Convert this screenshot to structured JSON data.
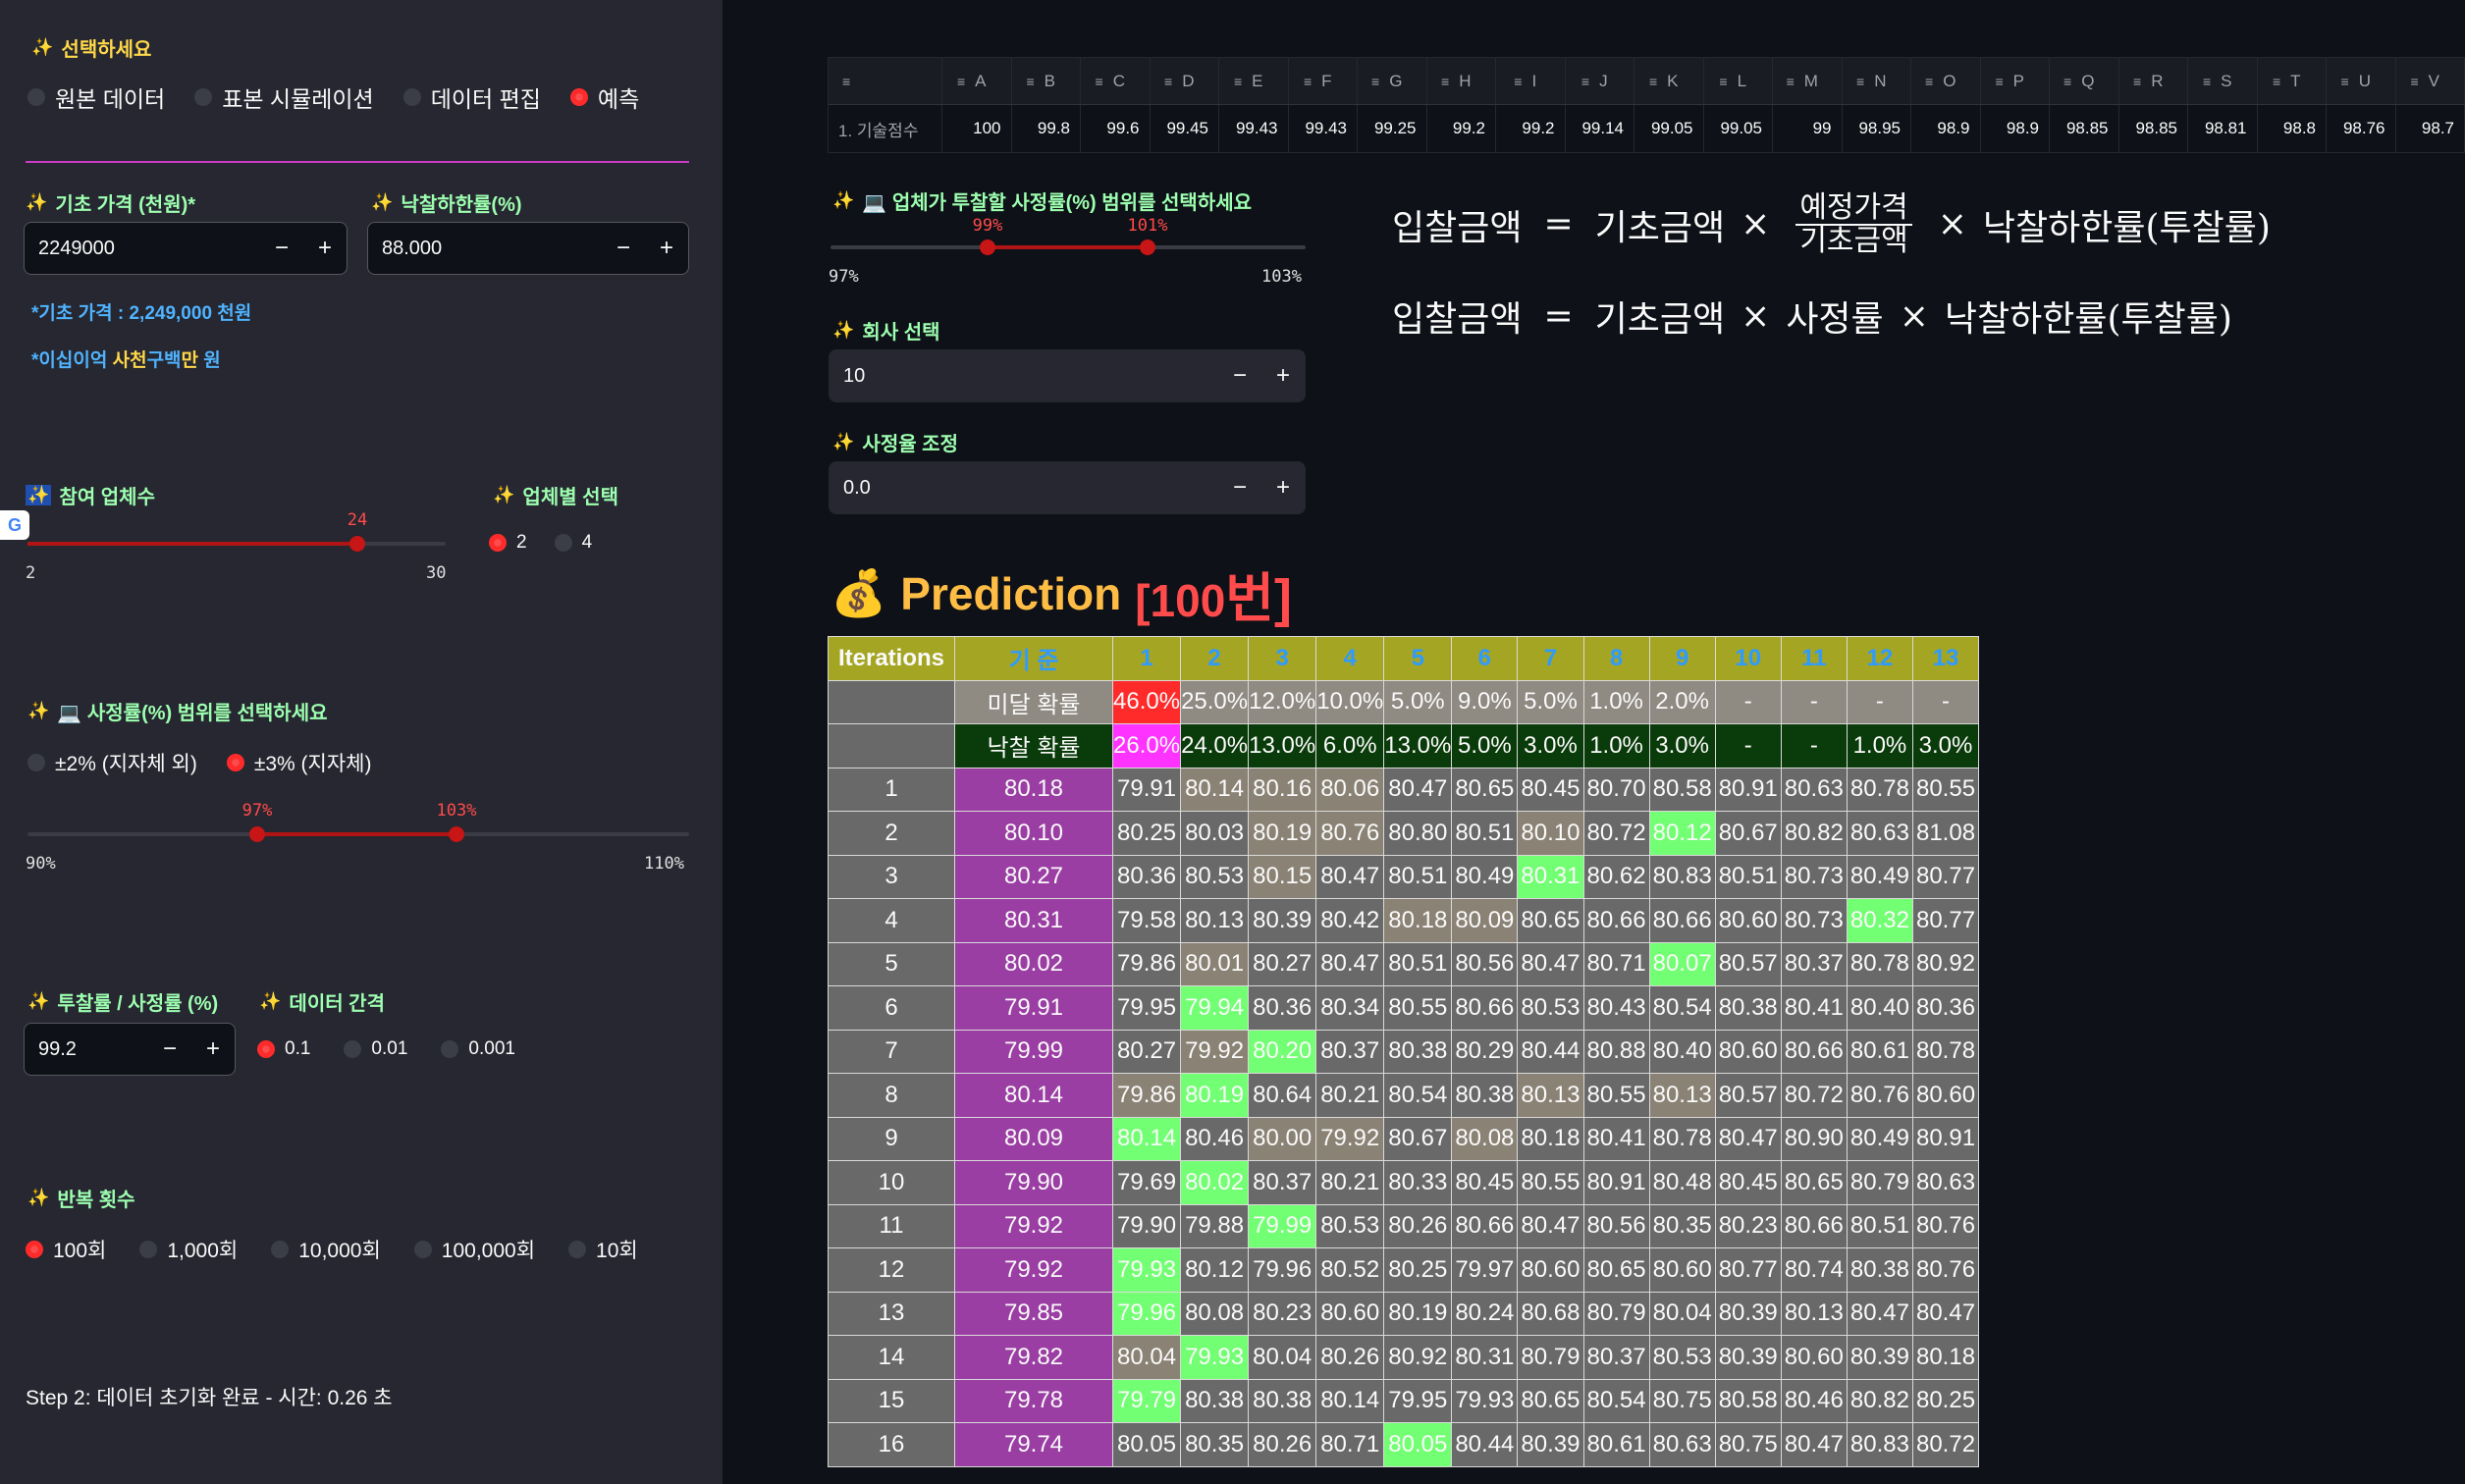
{
  "sidebar": {
    "select_label": "선택하세요",
    "mode_options": [
      "원본 데이터",
      "표본 시뮬레이션",
      "데이터 편집",
      "예측"
    ],
    "mode_selected": 3,
    "base_price_label": "기초 가격 (천원)*",
    "base_price_value": "2249000",
    "lower_rate_label": "낙찰하한률(%)",
    "lower_rate_value": "88.000",
    "base_price_info_prefix": "*기초 가격 : ",
    "base_price_info_value": "2,249,000",
    "base_price_info_suffix": " 천원",
    "price_words_prefix": "*",
    "price_words_blue1": "이십이억 ",
    "price_words_yellow1": "사천",
    "price_words_blue2": "구백",
    "price_words_yellow2": "만",
    "price_words_suffix": " 원",
    "participants_label": "참여 업체수",
    "participants_value": "24",
    "participants_min": "2",
    "participants_max": "30",
    "per_company_label": "업체별 선택",
    "per_company_options": [
      "2",
      "4"
    ],
    "per_company_selected": 0,
    "rate_range_label": "💻 사정률(%) 범위를 선택하세요",
    "rate_range_options": [
      "±2% (지자체 외)",
      "±3% (지자체)"
    ],
    "rate_range_selected": 1,
    "rate_slider_low": "97%",
    "rate_slider_high": "103%",
    "rate_slider_min": "90%",
    "rate_slider_max": "110%",
    "bid_rate_label": "투찰률 / 사정률 (%)",
    "bid_rate_value": "99.2",
    "interval_label": "데이터 간격",
    "interval_options": [
      "0.1",
      "0.01",
      "0.001"
    ],
    "interval_selected": 0,
    "repeat_label": "반복 횟수",
    "repeat_options": [
      "100회",
      "1,000회",
      "10,000회",
      "100,000회",
      "10회"
    ],
    "repeat_selected": 0,
    "step_text": "Step 2: 데이터 초기화 완료 - 시간: 0.26 초"
  },
  "top_table": {
    "headers": [
      "A",
      "B",
      "C",
      "D",
      "E",
      "F",
      "G",
      "H",
      "I",
      "J",
      "K",
      "L",
      "M",
      "N",
      "O",
      "P",
      "Q",
      "R",
      "S",
      "T",
      "U",
      "V"
    ],
    "row_label": "1. 기술점수",
    "values": [
      "100",
      "99.8",
      "99.6",
      "99.45",
      "99.43",
      "99.43",
      "99.25",
      "99.2",
      "99.2",
      "99.14",
      "99.05",
      "99.05",
      "99",
      "98.95",
      "98.9",
      "98.9",
      "98.85",
      "98.85",
      "98.81",
      "98.8",
      "98.76",
      "98.7"
    ]
  },
  "main_controls": {
    "company_range_label": "💻 업체가 투찰할 사정률(%) 범위를 선택하세요",
    "company_slider_low": "99%",
    "company_slider_high": "101%",
    "company_slider_min": "97%",
    "company_slider_max": "103%",
    "company_select_label": "회사 선택",
    "company_select_value": "10",
    "rate_adjust_label": "사정율 조정",
    "rate_adjust_value": "0.0"
  },
  "formula": {
    "line1_lhs": "입찰금액",
    "line1_a": "기초금액",
    "line1_num": "예정가격",
    "line1_den": "기초금액",
    "line1_b": "낙찰하한률(투찰률)",
    "line2_lhs": "입찰금액",
    "line2_a": "기초금액",
    "line2_b": "사정률",
    "line2_c": "낙찰하한률(투찰률)",
    "eq": "=",
    "times": "×"
  },
  "prediction": {
    "icon": "💰",
    "title": "Prediction",
    "bracket_num": "[100",
    "bracket_word": "번]",
    "iter_header": "Iterations",
    "base_header": "기 준",
    "columns": [
      "1",
      "2",
      "3",
      "4",
      "5",
      "6",
      "7",
      "8",
      "9",
      "10",
      "11",
      "12",
      "13"
    ],
    "miss_label": "미달 확률",
    "miss_values": [
      "46.0%",
      "25.0%",
      "12.0%",
      "10.0%",
      "5.0%",
      "9.0%",
      "5.0%",
      "1.0%",
      "2.0%",
      "-",
      "-",
      "-",
      "-"
    ],
    "win_label": "낙찰 확률",
    "win_values": [
      "26.0%",
      "24.0%",
      "13.0%",
      "6.0%",
      "13.0%",
      "5.0%",
      "3.0%",
      "1.0%",
      "3.0%",
      "-",
      "-",
      "1.0%",
      "3.0%"
    ],
    "rows": [
      {
        "i": "1",
        "base": "80.18",
        "v": [
          "79.91",
          "80.14",
          "80.16",
          "80.06",
          "80.47",
          "80.65",
          "80.45",
          "80.70",
          "80.58",
          "80.91",
          "80.63",
          "80.78",
          "80.55"
        ]
      },
      {
        "i": "2",
        "base": "80.10",
        "v": [
          "80.25",
          "80.03",
          "80.19",
          "80.76",
          "80.80",
          "80.51",
          "80.10",
          "80.72",
          "80.12",
          "80.67",
          "80.82",
          "80.63",
          "81.08"
        ]
      },
      {
        "i": "3",
        "base": "80.27",
        "v": [
          "80.36",
          "80.53",
          "80.15",
          "80.47",
          "80.51",
          "80.49",
          "80.31",
          "80.62",
          "80.83",
          "80.51",
          "80.73",
          "80.49",
          "80.77"
        ]
      },
      {
        "i": "4",
        "base": "80.31",
        "v": [
          "79.58",
          "80.13",
          "80.39",
          "80.42",
          "80.18",
          "80.09",
          "80.65",
          "80.66",
          "80.66",
          "80.60",
          "80.73",
          "80.32",
          "80.77"
        ]
      },
      {
        "i": "5",
        "base": "80.02",
        "v": [
          "79.86",
          "80.01",
          "80.27",
          "80.47",
          "80.51",
          "80.56",
          "80.47",
          "80.71",
          "80.07",
          "80.57",
          "80.37",
          "80.78",
          "80.92"
        ]
      },
      {
        "i": "6",
        "base": "79.91",
        "v": [
          "79.95",
          "79.94",
          "80.36",
          "80.34",
          "80.55",
          "80.66",
          "80.53",
          "80.43",
          "80.54",
          "80.38",
          "80.41",
          "80.40",
          "80.36"
        ]
      },
      {
        "i": "7",
        "base": "79.99",
        "v": [
          "80.27",
          "79.92",
          "80.20",
          "80.37",
          "80.38",
          "80.29",
          "80.44",
          "80.88",
          "80.40",
          "80.60",
          "80.66",
          "80.61",
          "80.78"
        ]
      },
      {
        "i": "8",
        "base": "80.14",
        "v": [
          "79.86",
          "80.19",
          "80.64",
          "80.21",
          "80.54",
          "80.38",
          "80.13",
          "80.55",
          "80.13",
          "80.57",
          "80.72",
          "80.76",
          "80.60"
        ]
      },
      {
        "i": "9",
        "base": "80.09",
        "v": [
          "80.14",
          "80.46",
          "80.00",
          "79.92",
          "80.67",
          "80.08",
          "80.18",
          "80.41",
          "80.78",
          "80.47",
          "80.90",
          "80.49",
          "80.91"
        ]
      },
      {
        "i": "10",
        "base": "79.90",
        "v": [
          "79.69",
          "80.02",
          "80.37",
          "80.21",
          "80.33",
          "80.45",
          "80.55",
          "80.91",
          "80.48",
          "80.45",
          "80.65",
          "80.79",
          "80.63"
        ]
      },
      {
        "i": "11",
        "base": "79.92",
        "v": [
          "79.90",
          "79.88",
          "79.99",
          "80.53",
          "80.26",
          "80.66",
          "80.47",
          "80.56",
          "80.35",
          "80.23",
          "80.66",
          "80.51",
          "80.76"
        ]
      },
      {
        "i": "12",
        "base": "79.92",
        "v": [
          "79.93",
          "80.12",
          "79.96",
          "80.52",
          "80.25",
          "79.97",
          "80.60",
          "80.65",
          "80.60",
          "80.77",
          "80.74",
          "80.38",
          "80.76"
        ]
      },
      {
        "i": "13",
        "base": "79.85",
        "v": [
          "79.96",
          "80.08",
          "80.23",
          "80.60",
          "80.19",
          "80.24",
          "80.68",
          "80.79",
          "80.04",
          "80.39",
          "80.13",
          "80.47",
          "80.47"
        ]
      },
      {
        "i": "14",
        "base": "79.82",
        "v": [
          "80.04",
          "79.93",
          "80.04",
          "80.26",
          "80.92",
          "80.31",
          "80.79",
          "80.37",
          "80.53",
          "80.39",
          "80.60",
          "80.39",
          "80.18"
        ]
      },
      {
        "i": "15",
        "base": "79.78",
        "v": [
          "79.79",
          "80.38",
          "80.38",
          "80.14",
          "79.95",
          "79.93",
          "80.65",
          "80.54",
          "80.75",
          "80.58",
          "80.46",
          "80.82",
          "80.25"
        ]
      },
      {
        "i": "16",
        "base": "79.74",
        "v": [
          "80.05",
          "80.35",
          "80.26",
          "80.71",
          "80.05",
          "80.44",
          "80.39",
          "80.61",
          "80.63",
          "80.75",
          "80.47",
          "80.83",
          "80.72"
        ]
      }
    ],
    "highlights": {
      "2": [
        9
      ],
      "3": [
        7
      ],
      "4": [
        12
      ],
      "5": [
        9
      ],
      "6": [
        2
      ],
      "7": [
        3
      ],
      "8": [
        2
      ],
      "9": [
        1
      ],
      "10": [
        2
      ],
      "11": [
        3
      ],
      "12": [
        1
      ],
      "13": [
        1
      ],
      "14": [
        2
      ],
      "15": [
        1
      ],
      "16": [
        5
      ]
    },
    "tan_cells": {
      "1": [
        2,
        3,
        4
      ],
      "2": [
        3,
        4,
        7
      ],
      "3": [
        3
      ],
      "4": [
        5,
        6
      ],
      "5": [
        2
      ],
      "7": [
        2
      ],
      "8": [
        1,
        7,
        9
      ],
      "9": [
        3,
        4,
        6
      ],
      "14": [
        1
      ]
    }
  },
  "colors": {
    "accent": "#ff4b4b",
    "label_green": "#9dffb0",
    "info_blue": "#4fb3ff",
    "header_olive": "#a5a524",
    "base_purple": "#9a3ea3",
    "highlight_green": "#73ff73"
  }
}
